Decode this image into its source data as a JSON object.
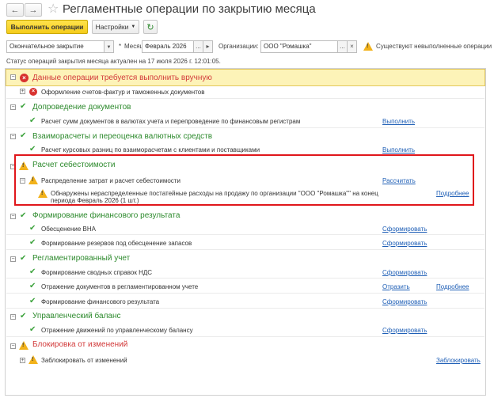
{
  "window": {
    "title": "Регламентные операции по закрытию месяца",
    "nav_back": "←",
    "nav_forward": "→",
    "star": "☆"
  },
  "toolbar": {
    "run_label": "Выполнить операции",
    "settings_label": "Настройки",
    "refresh_icon": "↻"
  },
  "filters": {
    "mode_value": "Окончательное закрытие",
    "month_label": "Месяц:",
    "month_value": "Февраль 2026",
    "org_label": "Организации:",
    "org_value": "ООО \"Ромашка\"",
    "warning_text": "Существуют невыполненные операции"
  },
  "status_text": "Статус операций закрытия месяца актуален на 17 июля 2026 г. 12:01:05.",
  "groups": [
    {
      "title": "Данные операции требуется выполнить вручную",
      "items": [
        {
          "label": "Оформление счетов-фактур и таможенных документов",
          "action": ""
        }
      ]
    },
    {
      "title": "Допроведение документов",
      "items": [
        {
          "label": "Расчет сумм документов в валютах учета и перепроведение по финансовым регистрам",
          "action": "Выполнить"
        }
      ]
    },
    {
      "title": "Взаиморасчеты и переоценка валютных средств",
      "items": [
        {
          "label": "Расчет курсовых разниц по взаиморасчетам с клиентами и поставщиками",
          "action": "Выполнить"
        }
      ]
    },
    {
      "title": "Расчет себестоимости",
      "items": [
        {
          "label": "Распределение затрат и расчет себестоимости",
          "action": "Рассчитать"
        }
      ],
      "warning": {
        "line1": "Обнаружены нераспределенные постатейные расходы на продажу по организации \"ООО \"Ромашка\"\" на конец",
        "line2": "периода Февраль 2026 (1 шт.)",
        "more": "Подробнее"
      }
    },
    {
      "title": "Формирование финансового результата",
      "items": [
        {
          "label": "Обесценение ВНА",
          "action": "Сформировать"
        },
        {
          "label": "Формирование резервов под обесценение запасов",
          "action": "Сформировать"
        }
      ]
    },
    {
      "title": "Регламентированный учет",
      "items": [
        {
          "label": "Формирование сводных справок НДС",
          "action": "Сформировать"
        },
        {
          "label": "Отражение документов в регламентированном учете",
          "action": "Отразить",
          "action2": "Подробнее"
        },
        {
          "label": "Формирование финансового результата",
          "action": "Сформировать"
        }
      ]
    },
    {
      "title": "Управленческий баланс",
      "items": [
        {
          "label": "Отражение движений по управленческому балансу",
          "action": "Сформировать"
        }
      ]
    },
    {
      "title": "Блокировка от изменений",
      "items": [
        {
          "label": "Заблокировать от изменений",
          "action": "Заблокировать"
        }
      ]
    }
  ],
  "colors": {
    "accent_yellow": "#f5cc1a",
    "group_green": "#2d8a2d",
    "group_red": "#d23a3a",
    "link_blue": "#1f5fb6",
    "highlight_red": "#e0161b"
  }
}
